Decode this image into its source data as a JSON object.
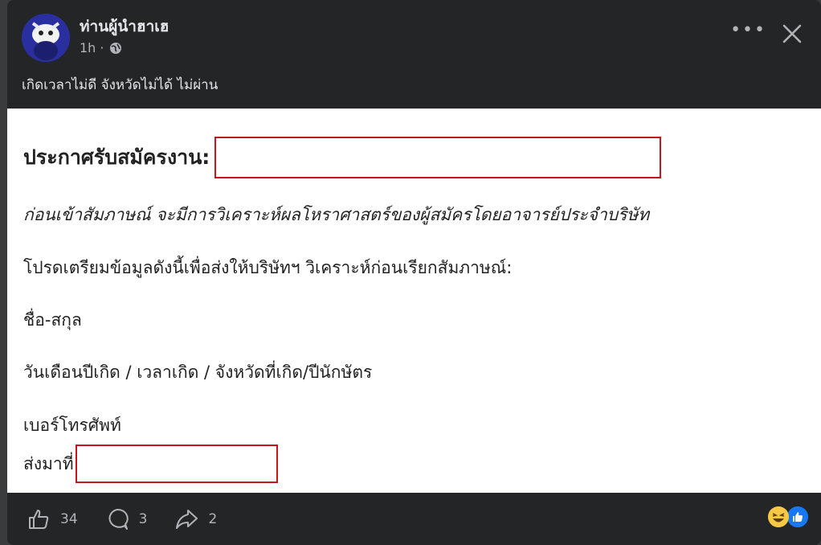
{
  "post": {
    "author": "ท่านผู้นำฮาเฮ",
    "time": "1h ·",
    "privacy_icon": "globe-icon",
    "caption": "เกิดเวลาไม่ดี จังหวัดไม่ได้ ไม่ผ่าน"
  },
  "image": {
    "heading": "ประกาศรับสมัครงาน:",
    "subtitle": "ก่อนเข้าสัมภาษณ์ จะมีการวิเคราะห์ผลโหราศาสตร์ของผู้สมัครโดยอาจารย์ประจำบริษัท",
    "instruction": "โปรดเตรียมข้อมูลดังนี้เพื่อส่งให้บริษัทฯ วิเคราะห์ก่อนเรียกสัมภาษณ์:",
    "field_name": "ชื่อ-สกุล",
    "field_birth": "วันเดือนปีเกิด / เวลาเกิด / จังหวัดที่เกิด/ปีนักษัตร",
    "field_phone": "เบอร์โทรศัพท์",
    "send_to": "ส่งมาที่"
  },
  "footer": {
    "likes": "34",
    "comments": "3",
    "shares": "2"
  },
  "colors": {
    "card_bg": "#242526",
    "redact": "#c4161c",
    "like_blue": "#1877f2"
  }
}
